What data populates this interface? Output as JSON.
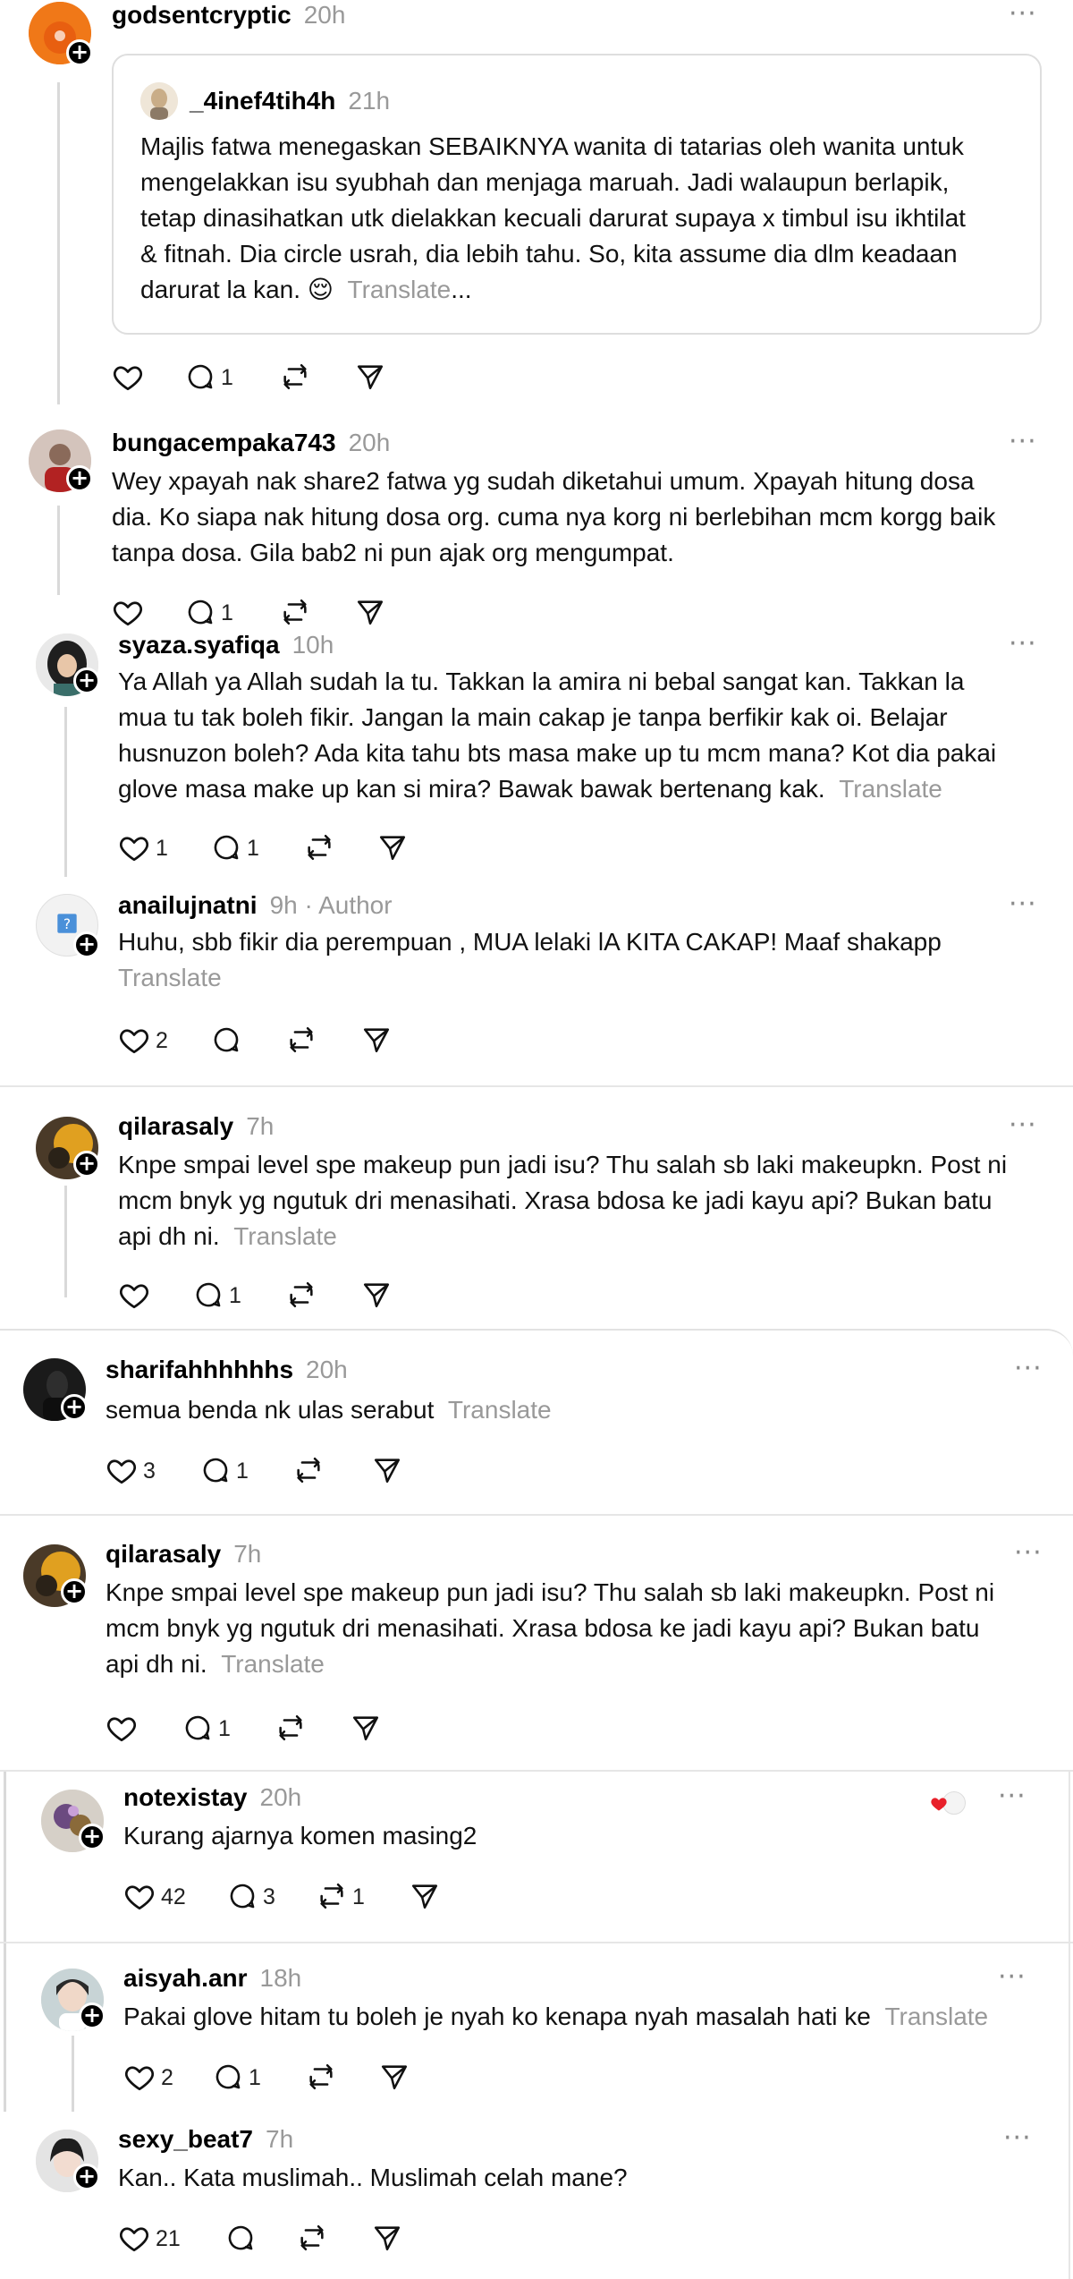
{
  "translate_label": "Translate",
  "posts": [
    {
      "username": "godsentcryptic",
      "time": "20h",
      "avatar_color": "#f07818",
      "quote": {
        "username": "_4inef4tih4h",
        "time": "21h",
        "lines": [
          "Majlis fatwa menegaskan SEBAIKNYA wanita di tatarias oleh wanita untuk",
          "mengelakkan isu syubhah dan menjaga maruah. Jadi walaupun berlapik,",
          "tetap dinasihatkan utk dielakkan kecuali darurat supaya x timbul isu ikhtilat",
          "& fitnah. Dia circle usrah, dia lebih tahu. So, kita assume dia dlm keadaan",
          "darurat la kan. 😌"
        ],
        "translate": "Translate",
        "ellipsis": "..."
      },
      "likes": "",
      "replies": "1",
      "reposts": ""
    },
    {
      "username": "bungacempaka743",
      "time": "20h",
      "avatar_color": "#c9b7b0",
      "lines": [
        "Wey xpayah nak share2 fatwa yg sudah diketahui umum. Xpayah hitung dosa",
        "dia. Ko siapa nak hitung dosa org. cuma nya korg ni berlebihan mcm korgg baik",
        "tanpa dosa. Gila bab2 ni pun ajak org mengumpat."
      ],
      "likes": "",
      "replies": "1",
      "reposts": ""
    },
    {
      "username": "syaza.syafiqa",
      "time": "10h",
      "avatar_color": "#2a2a2a",
      "lines": [
        "Ya Allah ya Allah sudah la tu. Takkan la amira ni bebal sangat kan. Takkan la",
        "mua tu tak boleh fikir. Jangan la main cakap je tanpa berfikir kak oi. Belajar",
        "husnuzon boleh? Ada kita tahu bts masa make up tu mcm mana? Kot dia pakai",
        "glove masa make up kan si mira? Bawak bawak bertenang kak."
      ],
      "likes": "1",
      "replies": "1",
      "reposts": ""
    },
    {
      "username": "anailujnatni",
      "time": "9h",
      "author_tag": "· Author",
      "avatar_color": "#f2f2f2",
      "lines": [
        "Huhu, sbb fikir dia perempuan , MUA lelaki lA KITA CAKAP! Maaf shakapp"
      ],
      "likes": "2",
      "replies": "",
      "reposts": ""
    },
    {
      "username": "qilarasaly",
      "time": "7h",
      "avatar_color": "#d9a21c",
      "lines": [
        "Knpe smpai level spe makeup pun jadi isu? Thu salah sb laki makeupkn. Post ni",
        "mcm bnyk yg ngutuk dri menasihati. Xrasa bdosa ke jadi kayu api? Bukan batu",
        "api dh ni."
      ],
      "likes": "",
      "replies": "1",
      "reposts": ""
    },
    {
      "username": "sharifahhhhhhs",
      "time": "20h",
      "avatar_color": "#1c1c1c",
      "lines": [
        "semua benda nk ulas serabut"
      ],
      "likes": "3",
      "replies": "1",
      "reposts": ""
    },
    {
      "username": "qilarasaly",
      "time": "7h",
      "avatar_color": "#d9a21c",
      "lines": [
        "Knpe smpai level spe makeup pun jadi isu? Thu salah sb laki makeupkn. Post ni",
        "mcm bnyk yg ngutuk dri menasihati. Xrasa bdosa ke jadi kayu api? Bukan batu",
        "api dh ni."
      ],
      "likes": "",
      "replies": "1",
      "reposts": ""
    },
    {
      "username": "notexistay",
      "time": "20h",
      "avatar_color": "#6b5a80",
      "lines": [
        "Kurang ajarnya komen masing2"
      ],
      "likes": "42",
      "replies": "3",
      "reposts": "1"
    },
    {
      "username": "aisyah.anr",
      "time": "18h",
      "avatar_color": "#b7c6c8",
      "lines": [
        "Pakai glove hitam tu boleh je nyah ko kenapa nyah masalah hati ke"
      ],
      "likes": "2",
      "replies": "1",
      "reposts": ""
    },
    {
      "username": "sexy_beat7",
      "time": "7h",
      "avatar_color": "#dcdcdc",
      "lines": [
        "Kan.. Kata muslimah.. Muslimah celah mane?"
      ],
      "likes": "21",
      "replies": "",
      "reposts": ""
    }
  ]
}
